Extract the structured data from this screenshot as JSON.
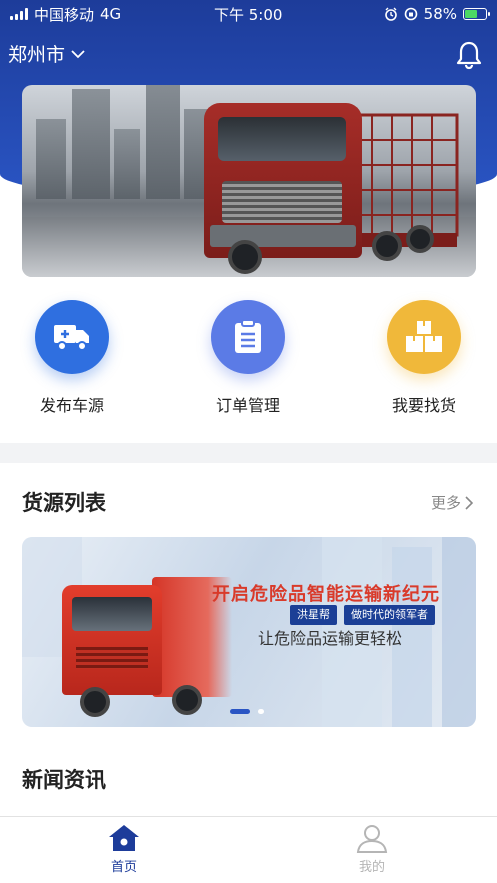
{
  "status_bar": {
    "carrier": "中国移动",
    "network": "4G",
    "time": "下午 5:00",
    "battery_percent": "58%",
    "battery_level": 0.58
  },
  "header": {
    "city": "郑州市",
    "icons": {
      "city_dropdown": "chevron-down-icon",
      "notifications": "bell-icon"
    }
  },
  "quick_actions": [
    {
      "label": "发布车源",
      "icon": "truck-icon",
      "color": "#2f6fe0"
    },
    {
      "label": "订单管理",
      "icon": "clipboard-icon",
      "color": "#5b7be6"
    },
    {
      "label": "我要找货",
      "icon": "boxes-icon",
      "color": "#f0b83a"
    }
  ],
  "cargo_section": {
    "title": "货源列表",
    "more": "更多"
  },
  "promo_banner": {
    "headline": "开启危险品智能运输新纪元",
    "tags": [
      "洪星帮",
      "做时代的领军者"
    ],
    "subline": "让危险品运输更轻松"
  },
  "news_section": {
    "title": "新闻资讯"
  },
  "tab_bar": [
    {
      "label": "首页",
      "icon": "home-icon",
      "active": true
    },
    {
      "label": "我的",
      "icon": "user-icon",
      "active": false
    }
  ],
  "colors": {
    "brand_blue": "#2a55c4",
    "active_tab": "#1d3c9a",
    "inactive_tab": "#b5b5b5"
  }
}
